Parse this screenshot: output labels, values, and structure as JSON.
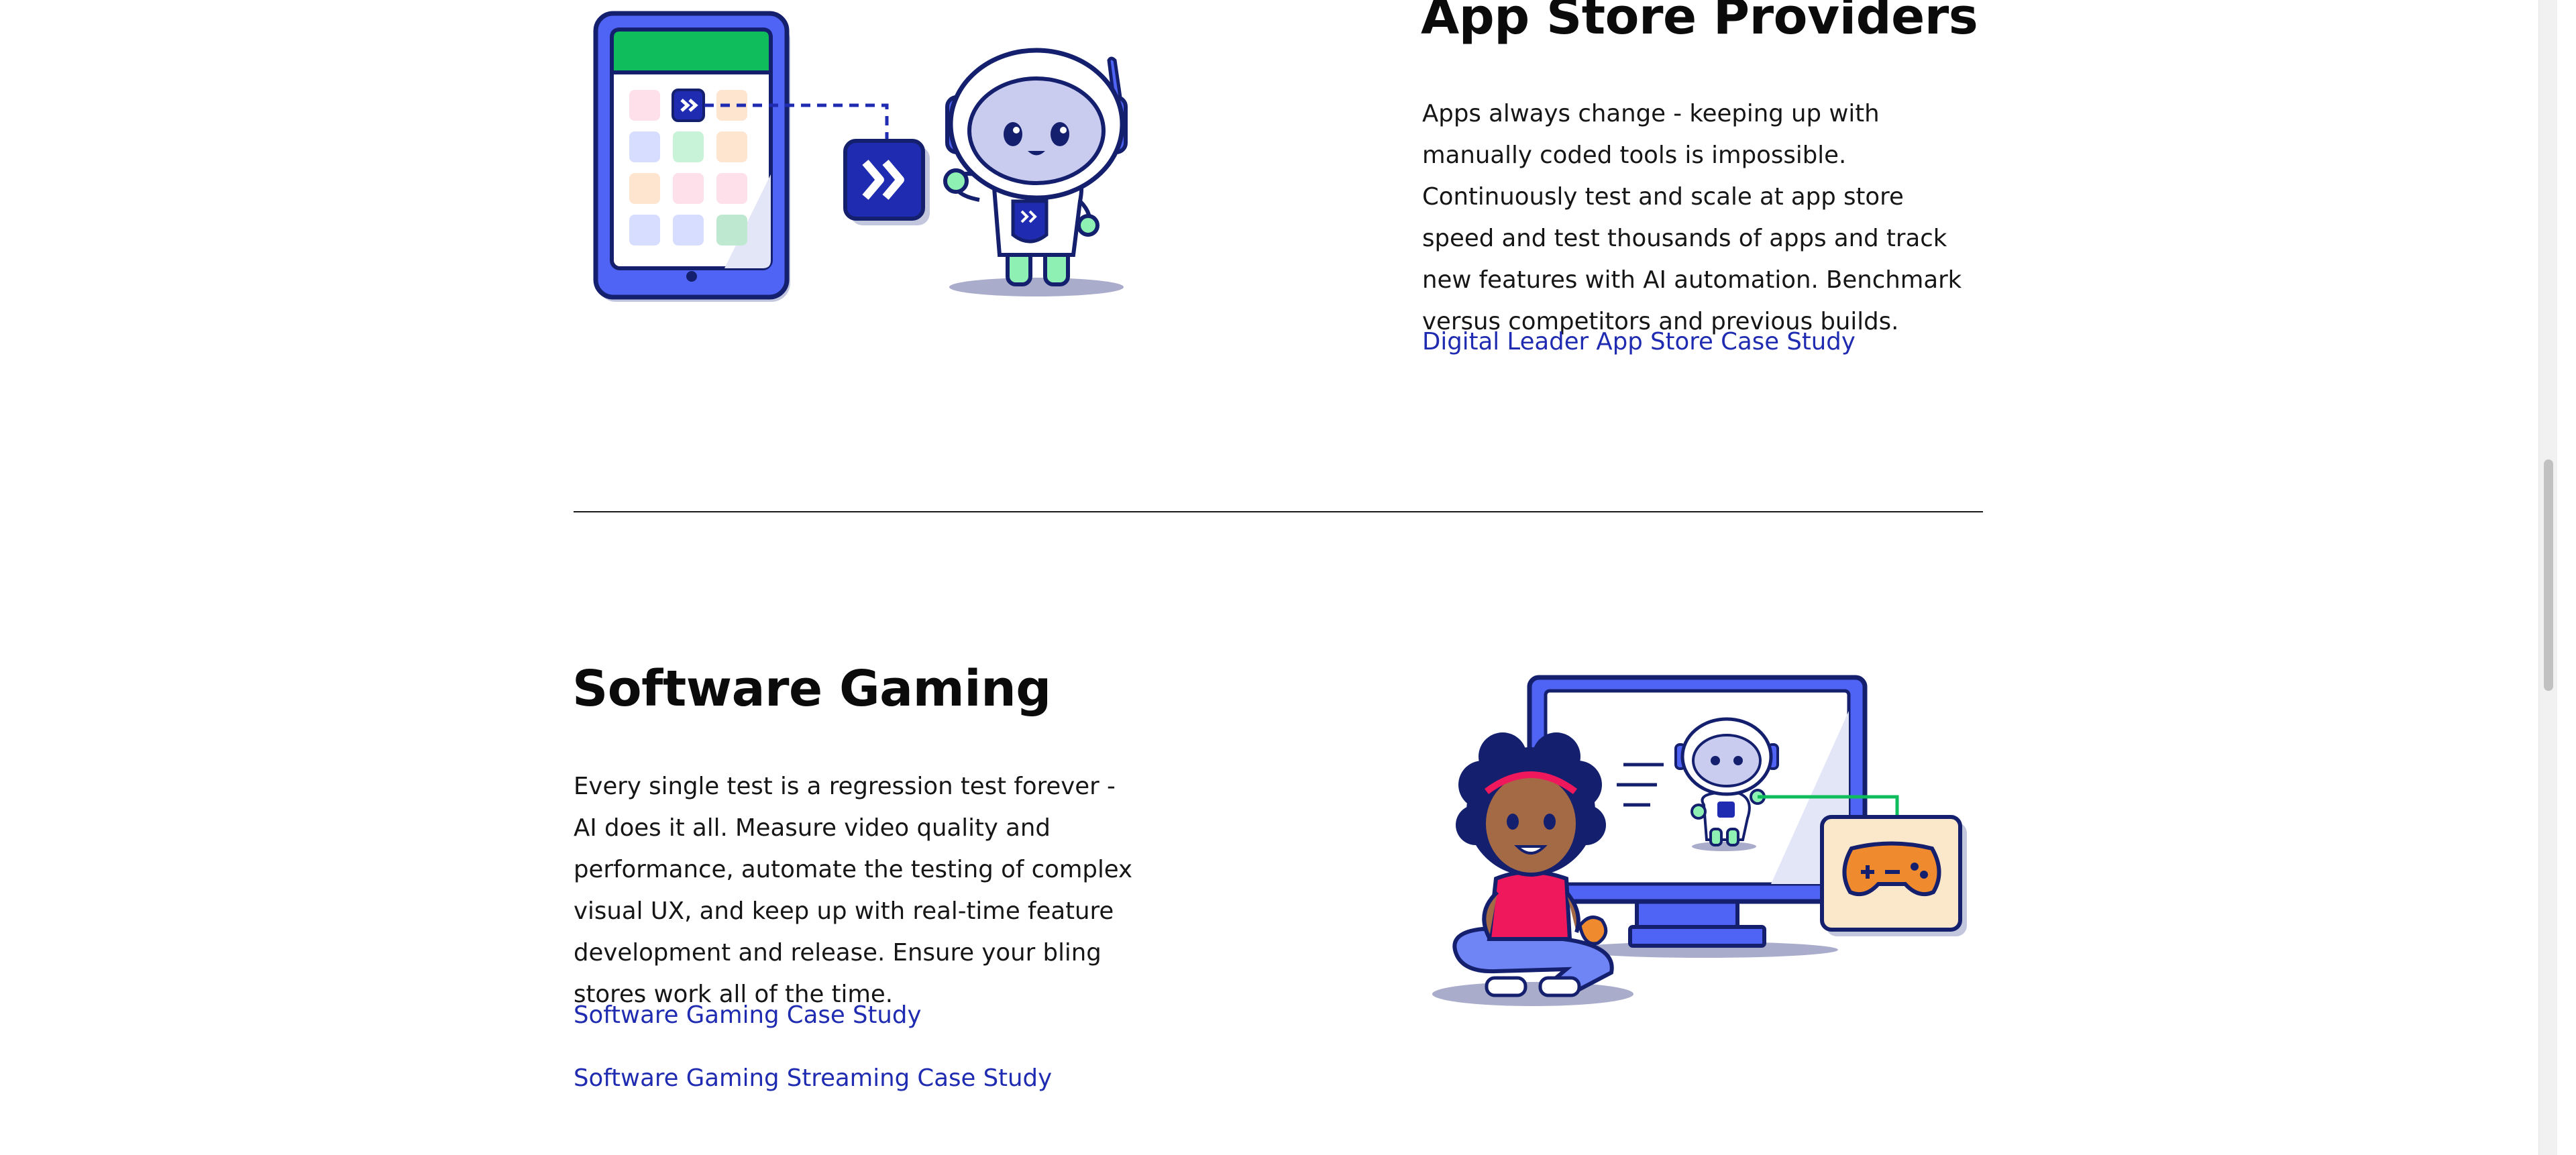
{
  "app_store": {
    "title": "App Store Providers",
    "description": "Apps always change - keeping up with manually coded tools is impossible. Continuously test and scale at app store speed and test thousands of apps and track new features with AI automation. Benchmark versus competitors and previous builds.",
    "links": [
      "Digital Leader App Store Case Study"
    ]
  },
  "gaming": {
    "title": "Software Gaming",
    "description": "Every single test is a regression test forever - AI does it all. Measure video quality and performance, automate the testing of complex visual UX, and keep up with real-time feature development and release. Ensure your bling stores work all of the time.",
    "links": [
      "Software Gaming Case Study",
      "Software Gaming Streaming Case Study"
    ]
  },
  "colors": {
    "brand_blue": "#1f2bb0",
    "illustration_blue": "#4f63f5",
    "navy": "#14206e",
    "green": "#1fbf5f"
  },
  "icons": [
    "tablet-icon",
    "app-icon",
    "robot-icon",
    "monitor-icon",
    "girl-figure",
    "gamepad-icon"
  ]
}
